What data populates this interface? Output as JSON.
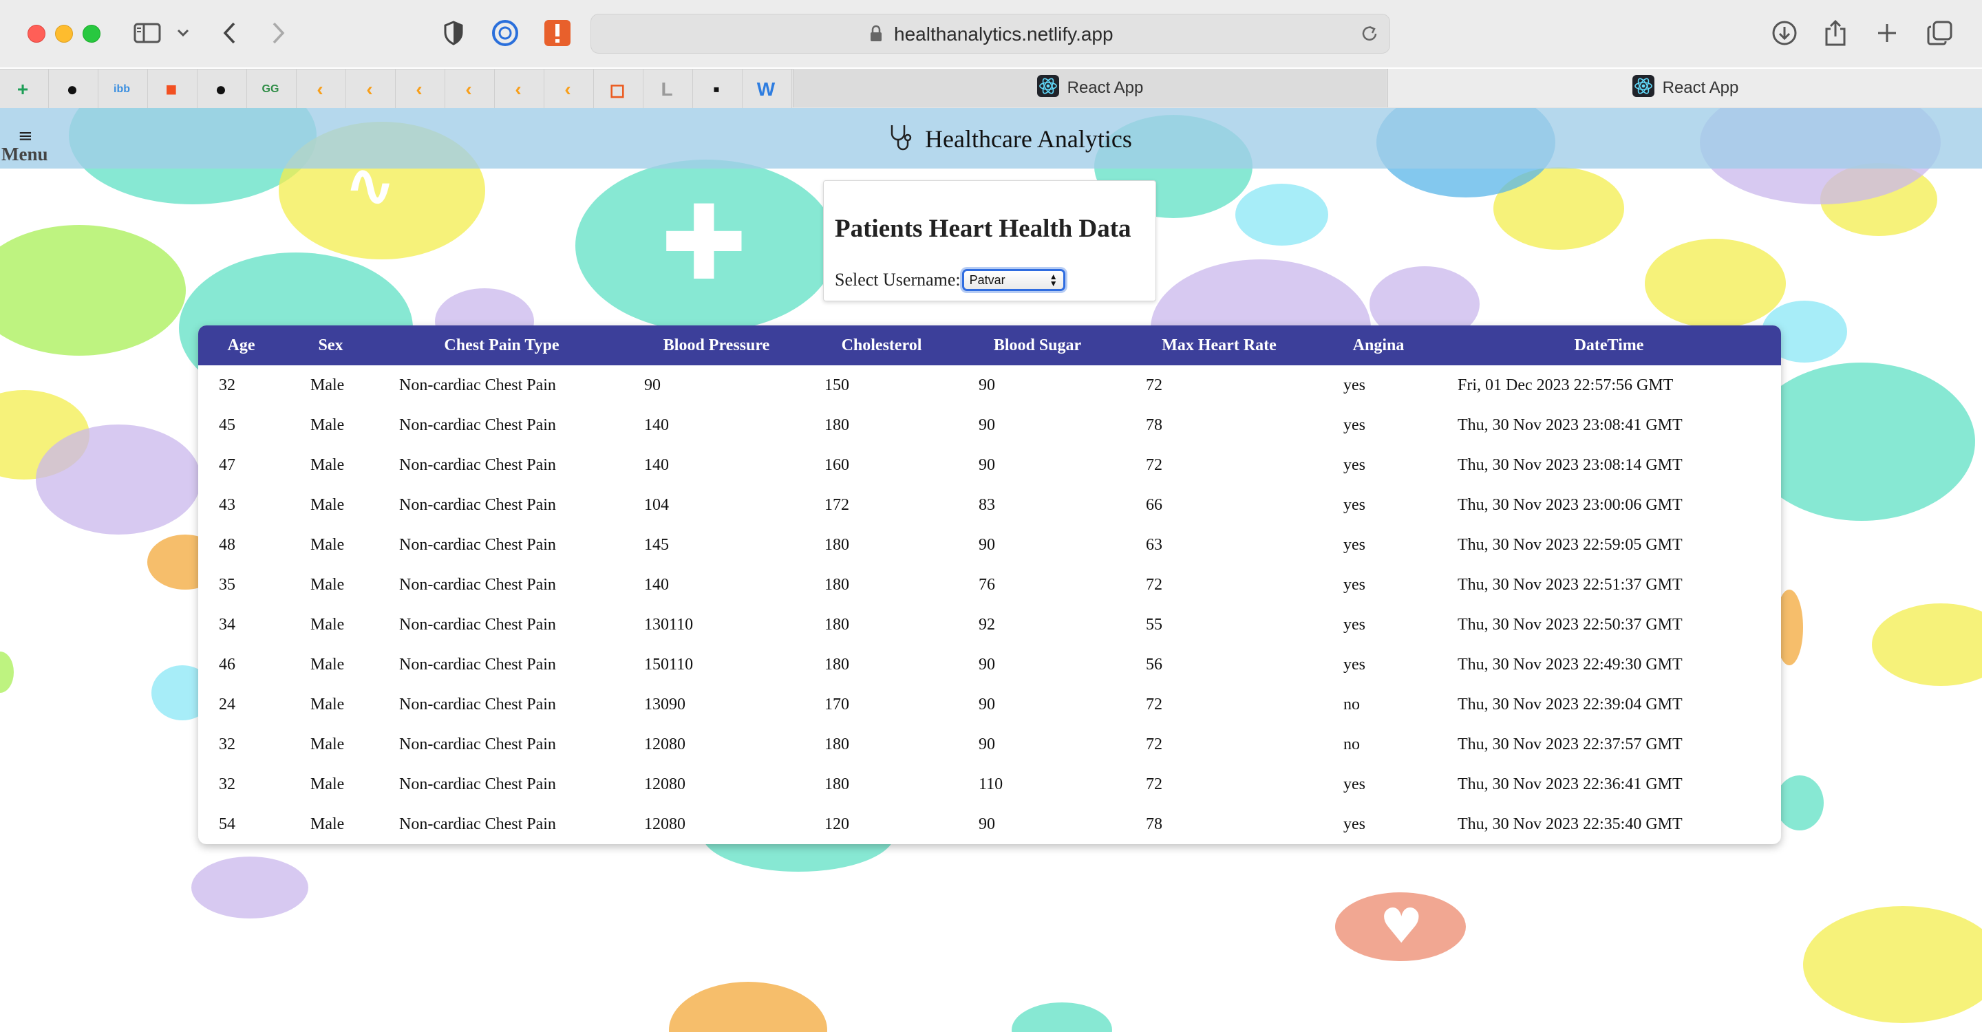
{
  "browser": {
    "url": "healthanalytics.netlify.app",
    "tabs": [
      {
        "label": "React App"
      },
      {
        "label": "React App"
      }
    ],
    "favorites": [
      {
        "icon": "sheets-icon",
        "color": "#1e9e57",
        "glyph": "+"
      },
      {
        "icon": "github-icon",
        "color": "#111111",
        "glyph": "●"
      },
      {
        "icon": "ibb-icon",
        "color": "#3b8fe0",
        "glyph": "ibb"
      },
      {
        "icon": "microsoft-icon",
        "color": "#f25022",
        "glyph": "■"
      },
      {
        "icon": "github-icon",
        "color": "#111111",
        "glyph": "●"
      },
      {
        "icon": "geeksforgeeks-icon",
        "color": "#2f8d46",
        "glyph": "GG"
      },
      {
        "icon": "leetcode-icon",
        "color": "#f89f1b",
        "glyph": "‹"
      },
      {
        "icon": "leetcode-icon",
        "color": "#f89f1b",
        "glyph": "‹"
      },
      {
        "icon": "leetcode-icon",
        "color": "#f89f1b",
        "glyph": "‹"
      },
      {
        "icon": "leetcode-icon",
        "color": "#f89f1b",
        "glyph": "‹"
      },
      {
        "icon": "leetcode-icon",
        "color": "#f89f1b",
        "glyph": "‹"
      },
      {
        "icon": "leetcode-icon",
        "color": "#f89f1b",
        "glyph": "‹"
      },
      {
        "icon": "office-icon",
        "color": "#eb5a1f",
        "glyph": "◻"
      },
      {
        "icon": "l-icon",
        "color": "#9a9a9a",
        "glyph": "L"
      },
      {
        "icon": "dark-app-icon",
        "color": "#111111",
        "glyph": "▪"
      },
      {
        "icon": "w-icon",
        "color": "#2e7de0",
        "glyph": "W"
      }
    ]
  },
  "header": {
    "menu_label": "Menu",
    "menu_glyph": "≡",
    "title": "Healthcare Analytics"
  },
  "select_card": {
    "heading": "Patients Heart Health Data",
    "label": "Select Username:",
    "selected": "Patvar"
  },
  "table": {
    "columns": [
      "Age",
      "Sex",
      "Chest Pain Type",
      "Blood Pressure",
      "Cholesterol",
      "Blood Sugar",
      "Max Heart Rate",
      "Angina",
      "DateTime"
    ],
    "rows": [
      [
        "32",
        "Male",
        "Non-cardiac Chest Pain",
        "90",
        "150",
        "90",
        "72",
        "yes",
        "Fri, 01 Dec 2023 22:57:56 GMT"
      ],
      [
        "45",
        "Male",
        "Non-cardiac Chest Pain",
        "140",
        "180",
        "90",
        "78",
        "yes",
        "Thu, 30 Nov 2023 23:08:41 GMT"
      ],
      [
        "47",
        "Male",
        "Non-cardiac Chest Pain",
        "140",
        "160",
        "90",
        "72",
        "yes",
        "Thu, 30 Nov 2023 23:08:14 GMT"
      ],
      [
        "43",
        "Male",
        "Non-cardiac Chest Pain",
        "104",
        "172",
        "83",
        "66",
        "yes",
        "Thu, 30 Nov 2023 23:00:06 GMT"
      ],
      [
        "48",
        "Male",
        "Non-cardiac Chest Pain",
        "145",
        "180",
        "90",
        "63",
        "yes",
        "Thu, 30 Nov 2023 22:59:05 GMT"
      ],
      [
        "35",
        "Male",
        "Non-cardiac Chest Pain",
        "140",
        "180",
        "76",
        "72",
        "yes",
        "Thu, 30 Nov 2023 22:51:37 GMT"
      ],
      [
        "34",
        "Male",
        "Non-cardiac Chest Pain",
        "130110",
        "180",
        "92",
        "55",
        "yes",
        "Thu, 30 Nov 2023 22:50:37 GMT"
      ],
      [
        "46",
        "Male",
        "Non-cardiac Chest Pain",
        "150110",
        "180",
        "90",
        "56",
        "yes",
        "Thu, 30 Nov 2023 22:49:30 GMT"
      ],
      [
        "24",
        "Male",
        "Non-cardiac Chest Pain",
        "13090",
        "170",
        "90",
        "72",
        "no",
        "Thu, 30 Nov 2023 22:39:04 GMT"
      ],
      [
        "32",
        "Male",
        "Non-cardiac Chest Pain",
        "12080",
        "180",
        "90",
        "72",
        "no",
        "Thu, 30 Nov 2023 22:37:57 GMT"
      ],
      [
        "32",
        "Male",
        "Non-cardiac Chest Pain",
        "12080",
        "180",
        "110",
        "72",
        "yes",
        "Thu, 30 Nov 2023 22:36:41 GMT"
      ],
      [
        "54",
        "Male",
        "Non-cardiac Chest Pain",
        "12080",
        "120",
        "90",
        "78",
        "yes",
        "Thu, 30 Nov 2023 22:35:40 GMT"
      ]
    ]
  },
  "colors": {
    "table_header": "#3c3f9a",
    "navbar": "#a0cde8",
    "select_focus": "#2f6ce0"
  }
}
